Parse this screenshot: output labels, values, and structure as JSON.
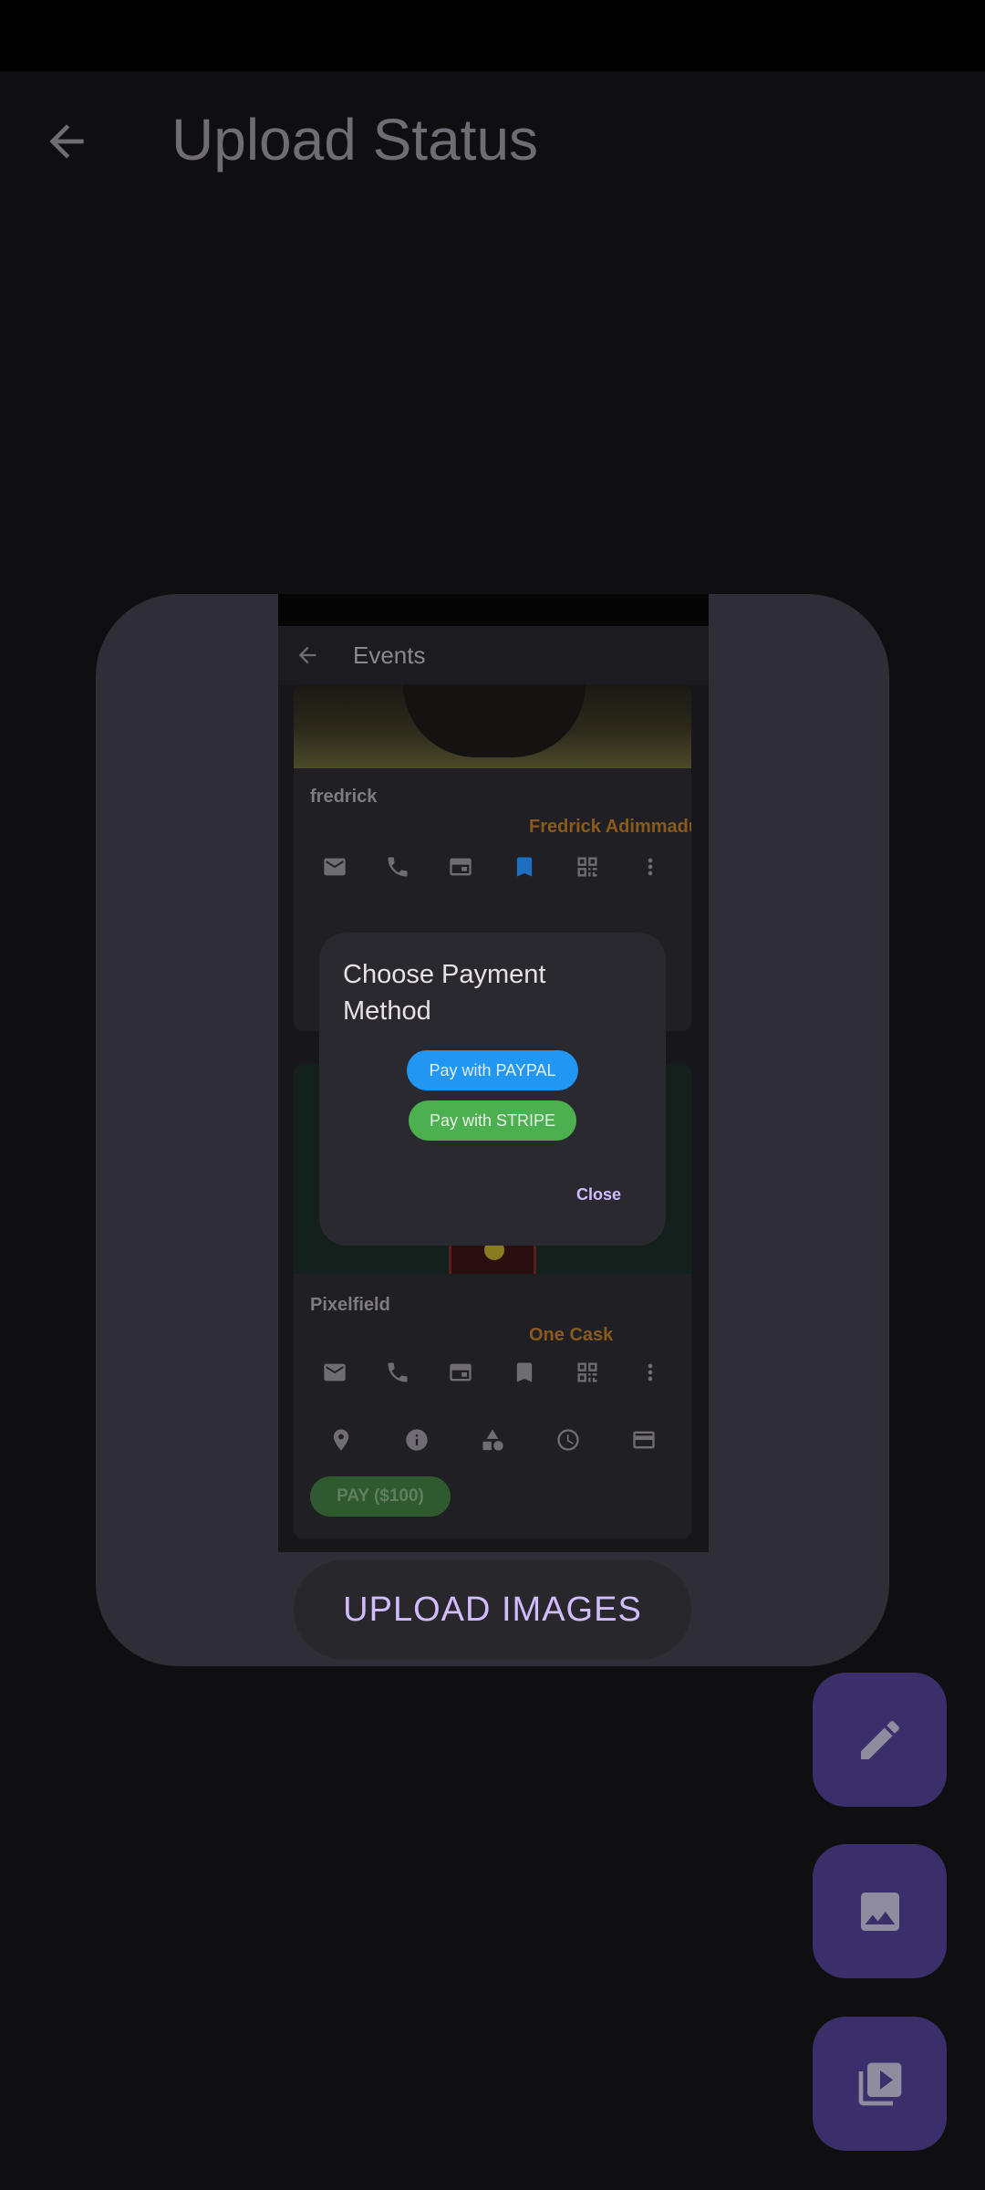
{
  "app_bar": {
    "title": "Upload Status"
  },
  "preview": {
    "app_bar_title": "Events",
    "events": [
      {
        "name": "fredrick",
        "organizer": "Fredrick Adimmadu J",
        "bookmarked": true,
        "bookmark_color": "#1e6fc2"
      },
      {
        "name": "Pixelfield",
        "organizer": "One Cask",
        "pay_label": "PAY ($100)"
      }
    ],
    "icon_row_1": [
      "mail-icon",
      "phone-icon",
      "card-icon",
      "bookmark-icon",
      "qr-code-icon",
      "more-vert-icon"
    ],
    "icon_row_2": [
      "location-icon",
      "info-icon",
      "category-icon",
      "clock-icon",
      "credit-card-icon"
    ]
  },
  "dialog": {
    "title": "Choose Payment Method",
    "paypal_label": "Pay with PAYPAL",
    "stripe_label": "Pay with STRIPE",
    "close_label": "Close",
    "paypal_color": "#2196f3",
    "stripe_color": "#4caf50"
  },
  "upload_button": {
    "label": "UPLOAD IMAGES"
  },
  "fabs": [
    "edit-icon",
    "image-icon",
    "video-library-icon"
  ]
}
